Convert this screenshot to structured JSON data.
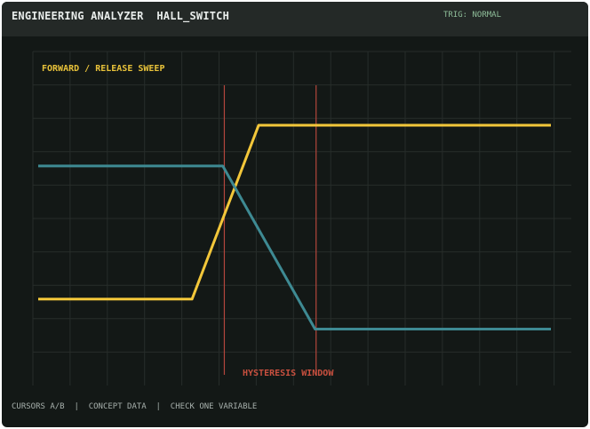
{
  "header": {
    "title": "ENGINEERING ANALYZER  HALL_SWITCH",
    "trigger": "TRIG: NORMAL"
  },
  "status": {
    "text": "CURSORS A/B  |  CONCEPT DATA  |  CHECK ONE VARIABLE"
  },
  "chart_data": {
    "type": "line",
    "title": "FORWARD / RELEASE SWEEP",
    "xlabel": "",
    "ylabel": "",
    "grid": true,
    "xlim": [
      0,
      100
    ],
    "ylim": [
      0,
      100
    ],
    "series": [
      {
        "color": "#f3c73a",
        "points": [
          [
            0,
            20
          ],
          [
            30,
            20
          ],
          [
            43,
            84
          ],
          [
            100,
            84
          ]
        ]
      },
      {
        "color": "#3e8a93",
        "points": [
          [
            0,
            69
          ],
          [
            36,
            69
          ],
          [
            54,
            9
          ],
          [
            100,
            9
          ]
        ]
      }
    ],
    "cursors": [
      {
        "x": 36.3,
        "color": "#b3463c"
      },
      {
        "x": 54.2,
        "color": "#b3463c"
      }
    ],
    "annotations": [
      {
        "text": "HYSTERESIS WINDOW",
        "color": "#c9503f"
      }
    ]
  }
}
